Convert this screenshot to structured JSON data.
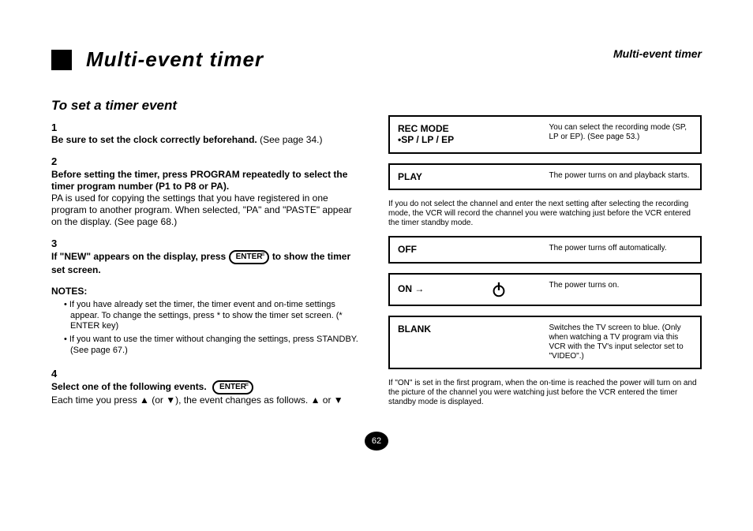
{
  "page": {
    "title": "Multi-event timer",
    "label": "Multi-event timer",
    "number": "62"
  },
  "left": {
    "heading": "To set a timer event",
    "steps": [
      {
        "num": "1",
        "first": "Be sure to set the clock correctly beforehand.",
        "rest": "(See page 34.)"
      },
      {
        "num": "2",
        "first": "Before setting the timer, press PROGRAM repeatedly to select the timer program number (P1 to P8 or PA).",
        "rest": "PA is used for copying the settings that you have registered in one program to another program. When selected, \"PA\" and \"PASTE\" appear on the display. (See page 68.)"
      },
      {
        "num": "3",
        "first": "If \"NEW\" appears on the display, press",
        "rest": " to show the timer set screen.",
        "enter": true
      }
    ],
    "notes_head": "NOTES:",
    "notes": [
      "If you have already set the timer, the timer event and on-time settings appear. To change the settings, press * to show the timer set screen. (* ENTER key)",
      "If you want to use the timer without changing the settings, press STANDBY. (See page 67.)"
    ],
    "step4": {
      "num": "4",
      "first": "Select one of the following events.",
      "rest": "Each time you press ▲ (or ▼), the event changes as follows. ▲ or ▼"
    }
  },
  "right": {
    "boxes": [
      {
        "title": "REC MODE\n•SP / LP / EP",
        "desc": "You can select the recording mode (SP, LP or EP). (See page 53.)"
      },
      {
        "title": "PLAY",
        "desc": "The power turns on and playback starts."
      }
    ],
    "note1": "If you do not select the channel and enter the next setting after selecting the recording mode, the VCR will record the channel you were watching just before the VCR entered the timer standby mode.",
    "boxes2": [
      {
        "title": "OFF",
        "desc": "The power turns off automatically."
      },
      {
        "title": "ON  →",
        "desc": "The power turns on.",
        "mark": true
      },
      {
        "title": "BLANK",
        "desc": "Switches the TV screen to blue. (Only when watching a TV program via this VCR with the TV's input selector set to \"VIDEO\".)"
      }
    ],
    "note2": "If \"ON\" is set in the first program, when the on-time is reached the power will turn on and the picture of the channel you were watching just before the VCR entered the timer standby mode is displayed."
  }
}
